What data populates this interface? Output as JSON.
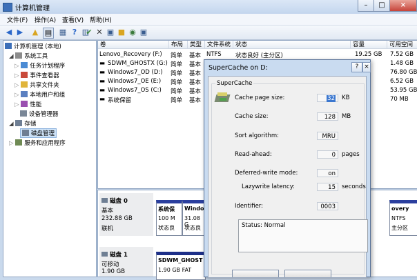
{
  "window": {
    "title": "计算机管理",
    "minimize": "–",
    "maximize": "□",
    "close": "×"
  },
  "menu": [
    "文件(F)",
    "操作(A)",
    "查看(V)",
    "帮助(H)"
  ],
  "tree": {
    "root": "计算机管理 (本地)",
    "system_tools": "系统工具",
    "task_scheduler": "任务计划程序",
    "event_viewer": "事件查看器",
    "shared_folders": "共享文件夹",
    "local_users": "本地用户和组",
    "performance": "性能",
    "device_manager": "设备管理器",
    "storage": "存储",
    "disk_management": "磁盘管理",
    "services": "服务和应用程序"
  },
  "volumes": {
    "headers": [
      "卷",
      "布局",
      "类型",
      "文件系统",
      "状态",
      "容量",
      "可用空间"
    ],
    "rows": [
      {
        "name": "Lenovo_Recovery (F:)",
        "layout": "简单",
        "type": "基本",
        "fs": "NTFS",
        "status": "状态良好 (主分区)",
        "cap": "19.25 GB",
        "free": "7.52 GB"
      },
      {
        "name": "SDWM_GHOSTX (G:)",
        "layout": "简单",
        "type": "基本",
        "fs": "",
        "status": "",
        "cap": "",
        "free": "1.48 GB"
      },
      {
        "name": "Windows7_OD (D:)",
        "layout": "简单",
        "type": "基本",
        "fs": "",
        "status": "",
        "cap": "",
        "free": "76.80 GB"
      },
      {
        "name": "Windows7_OE (E:)",
        "layout": "简单",
        "type": "基本",
        "fs": "",
        "status": "",
        "cap": "",
        "free": "6.52 GB"
      },
      {
        "name": "Windows7_OS (C:)",
        "layout": "简单",
        "type": "基本",
        "fs": "",
        "status": "",
        "cap": "",
        "free": "53.95 GB"
      },
      {
        "name": "系统保留",
        "layout": "简单",
        "type": "基本",
        "fs": "",
        "status": "",
        "cap": "",
        "free": "70 MB"
      }
    ]
  },
  "disks": [
    {
      "name": "磁盘 0",
      "type": "基本",
      "size": "232.88 GB",
      "state": "联机",
      "parts": [
        {
          "title": "系统保",
          "size": "100 M",
          "status": "状态良"
        },
        {
          "title": "Windo",
          "size": "31.08 G",
          "status": "状态良"
        },
        {
          "title": "overy",
          "size": "NTFS",
          "status": "主分区"
        }
      ]
    },
    {
      "name": "磁盘 1",
      "type": "可移动",
      "size": "1.90 GB",
      "state": "",
      "parts": [
        {
          "title": "SDWM_GHOST",
          "size": "1.90 GB FAT",
          "status": ""
        }
      ]
    }
  ],
  "dialog": {
    "title": "SuperCache on D:",
    "help": "?",
    "close": "×",
    "group": "SuperCache",
    "page_size_label": "Cache page size:",
    "page_size": "32",
    "page_size_unit": "KB",
    "cache_size_label": "Cache size:",
    "cache_size": "128",
    "cache_size_unit": "MB",
    "sort_label": "Sort algorithm:",
    "sort": "MRU",
    "readahead_label": "Read-ahead:",
    "readahead": "0",
    "readahead_unit": "pages",
    "deferred_label": "Deferred-write mode:",
    "deferred": "on",
    "lazy_label": "Lazywrite latency:",
    "lazy": "15",
    "lazy_unit": "seconds",
    "identifier_label": "Identifier:",
    "identifier": "0003",
    "status": "Status: Normal"
  }
}
